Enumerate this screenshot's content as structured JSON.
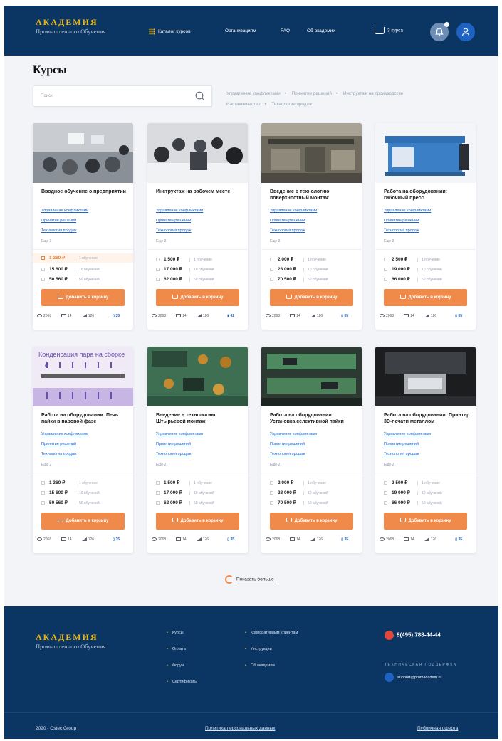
{
  "header": {
    "logo_title": "АКАДЕМИЯ",
    "logo_subtitle": "Промышленного Обучения",
    "nav": [
      "Каталог курсов",
      "Организациям",
      "FAQ",
      "Об академии"
    ],
    "cart_label": "3 курса"
  },
  "page_title": "Курсы",
  "search": {
    "placeholder": "Поиск"
  },
  "tags": [
    "Управление конфликтами",
    "Принятие решений",
    "Инструктаж на производстве",
    "Наставничество",
    "Технология продаж"
  ],
  "course_tags": [
    "Управление конфликтами",
    "Принятие решений",
    "Технология продаж"
  ],
  "more_label": "Еще 3",
  "more_label_2": "Еще 2",
  "add_label": "Добавить в корзину",
  "cards": [
    {
      "title": "Вводное обучение о предприятии",
      "prices": [
        {
          "amount": "1 260 ₽",
          "note": "1 обучение"
        },
        {
          "amount": "15 600 ₽",
          "note": "10 обучений"
        },
        {
          "amount": "50 560 ₽",
          "note": "50 обучений"
        }
      ],
      "views": "2068",
      "tests": "14",
      "level": "126",
      "saved": "35"
    },
    {
      "title": "Инструктаж на рабочем месте",
      "prices": [
        {
          "amount": "1 500 ₽",
          "note": "1 обучение"
        },
        {
          "amount": "17 000 ₽",
          "note": "10 обучений"
        },
        {
          "amount": "62 000 ₽",
          "note": "50 обучений"
        }
      ],
      "views": "2068",
      "tests": "14",
      "level": "126",
      "saved": "62"
    },
    {
      "title": "Введение в технологию поверхностный монтаж",
      "prices": [
        {
          "amount": "2 000 ₽",
          "note": "1 обучение"
        },
        {
          "amount": "23 000 ₽",
          "note": "10 обучений"
        },
        {
          "amount": "70 500 ₽",
          "note": "50 обучений"
        }
      ],
      "views": "2068",
      "tests": "14",
      "level": "126",
      "saved": "35"
    },
    {
      "title": "Работа на оборудовании: гибочный пресс",
      "prices": [
        {
          "amount": "2 500 ₽",
          "note": "1 обучение"
        },
        {
          "amount": "19 000 ₽",
          "note": "10 обучений"
        },
        {
          "amount": "66 000 ₽",
          "note": "50 обучений"
        }
      ],
      "views": "2068",
      "tests": "14",
      "level": "126",
      "saved": "35"
    },
    {
      "title": "Работа на оборудовании: Печь пайки в паровой фазе",
      "img_caption": "Конденсация пара на сборке",
      "prices": [
        {
          "amount": "1 360 ₽",
          "note": "1 обучение"
        },
        {
          "amount": "15 600 ₽",
          "note": "10 обучений"
        },
        {
          "amount": "50 560 ₽",
          "note": "50 обучений"
        }
      ],
      "views": "2068",
      "tests": "14",
      "level": "126",
      "saved": "35"
    },
    {
      "title": "Введение в технологию: Штырьевой монтаж",
      "prices": [
        {
          "amount": "1 500 ₽",
          "note": "1 обучение"
        },
        {
          "amount": "17 000 ₽",
          "note": "10 обучений"
        },
        {
          "amount": "62 000 ₽",
          "note": "50 обучений"
        }
      ],
      "views": "2068",
      "tests": "14",
      "level": "126",
      "saved": "35"
    },
    {
      "title": "Работа на оборудовании: Установка селективной пайки",
      "prices": [
        {
          "amount": "2 000 ₽",
          "note": "1 обучение"
        },
        {
          "amount": "23 000 ₽",
          "note": "10 обучений"
        },
        {
          "amount": "70 500 ₽",
          "note": "50 обучений"
        }
      ],
      "views": "2068",
      "tests": "14",
      "level": "126",
      "saved": "35"
    },
    {
      "title": "Работа на оборудовании: Принтер 3D-печати металлом",
      "prices": [
        {
          "amount": "2 500 ₽",
          "note": "1 обучение"
        },
        {
          "amount": "19 000 ₽",
          "note": "10 обучений"
        },
        {
          "amount": "66 000 ₽",
          "note": "50 обучений"
        }
      ],
      "views": "2068",
      "tests": "14",
      "level": "126",
      "saved": "35"
    }
  ],
  "show_more": "Показать больше",
  "footer": {
    "logo_title": "АКАДЕМИЯ",
    "logo_subtitle": "Промышленного Обучения",
    "col1": [
      "Курсы",
      "Оплата",
      "Форум",
      "Сертификаты"
    ],
    "col2": [
      "Корпоративным клиентам",
      "Инструкции",
      "Об академии"
    ],
    "phone": "8(495) 788-44-44",
    "support_label": "ТЕХНИЧЕСКАЯ ПОДДЕРЖКА",
    "email": "support@promacadem.ru",
    "copyright": "2020 - Ostec Group",
    "privacy": "Политика персональных данных",
    "offer": "Публичная оферта"
  },
  "colors": {
    "primary": "#0b3563",
    "accent": "#f08a4b",
    "logo": "#f2b705",
    "link": "#1e63c4"
  }
}
